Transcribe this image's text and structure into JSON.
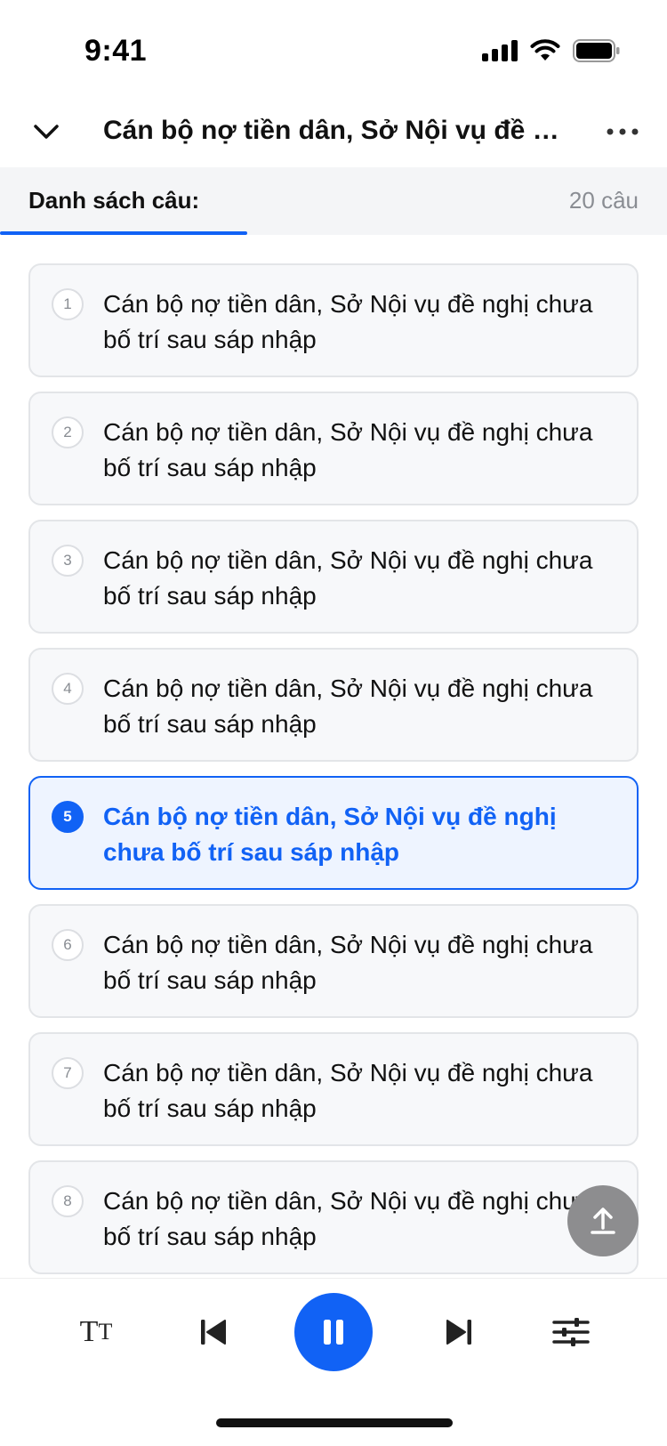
{
  "status_bar": {
    "time": "9:41"
  },
  "header": {
    "title": "Cán bộ nợ tiền dân, Sở Nội vụ đề ng..."
  },
  "section": {
    "label": "Danh sách câu:",
    "count": "20 câu",
    "progress_fraction": 0.37
  },
  "sentences": [
    {
      "number": "1",
      "text": "Cán bộ nợ tiền dân, Sở Nội vụ đề nghị chưa bố trí sau sáp nhập",
      "active": false
    },
    {
      "number": "2",
      "text": "Cán bộ nợ tiền dân, Sở Nội vụ đề nghị chưa bố trí sau sáp nhập",
      "active": false
    },
    {
      "number": "3",
      "text": "Cán bộ nợ tiền dân, Sở Nội vụ đề nghị chưa bố trí sau sáp nhập",
      "active": false
    },
    {
      "number": "4",
      "text": "Cán bộ nợ tiền dân, Sở Nội vụ đề nghị chưa bố trí sau sáp nhập",
      "active": false
    },
    {
      "number": "5",
      "text": "Cán bộ nợ tiền dân, Sở Nội vụ đề nghị chưa bố trí sau sáp nhập",
      "active": true
    },
    {
      "number": "6",
      "text": "Cán bộ nợ tiền dân, Sở Nội vụ đề nghị chưa bố trí sau sáp nhập",
      "active": false
    },
    {
      "number": "7",
      "text": "Cán bộ nợ tiền dân, Sở Nội vụ đề nghị chưa bố trí sau sáp nhập",
      "active": false
    },
    {
      "number": "8",
      "text": "Cán bộ nợ tiền dân, Sở Nội vụ đề nghị chưa bố trí sau sáp nhập",
      "active": false
    }
  ],
  "player": {
    "font_size_big": "T",
    "font_size_small": "T"
  },
  "colors": {
    "accent": "#1162f5",
    "card_bg": "#f7f8fa",
    "active_card_bg": "#eef4ff",
    "fab_bg": "#8d8d8f"
  },
  "icons": {
    "back": "chevron-down-icon",
    "more": "more-horizontal-icon",
    "scroll_top": "upload-arrow-icon",
    "font_size": "text-size-icon",
    "prev": "skip-previous-icon",
    "pause": "pause-icon",
    "next": "skip-next-icon",
    "settings": "sliders-icon"
  }
}
